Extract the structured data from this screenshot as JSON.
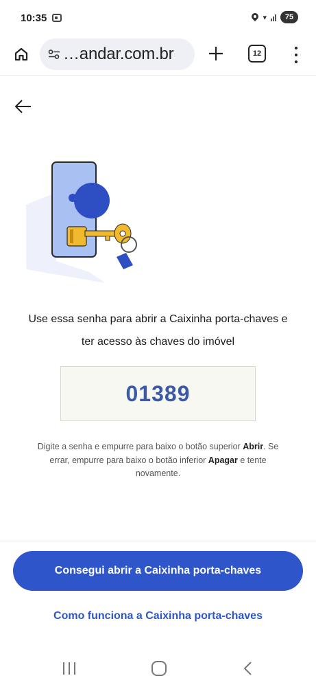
{
  "status_bar": {
    "time": "10:35",
    "battery": "75"
  },
  "browser": {
    "url": "…andar.com.br",
    "tab_count": "12",
    "icons": [
      "home-icon",
      "site-settings-icon",
      "plus-icon",
      "tab-switcher-icon",
      "more-vert-icon"
    ]
  },
  "page": {
    "instruction": "Use essa senha para abrir a Caixinha porta-chaves e ter acesso às chaves do imóvel",
    "code": "01389",
    "help": {
      "part1": "Digite a senha e empurre para baixo o botão superior ",
      "abrir": "Abrir",
      "part2": ". Se errar, empurre para baixo o botão inferior ",
      "apagar": "Apagar",
      "part3": " e tente novamente."
    },
    "primary_button": "Consegui abrir a Caixinha porta-chaves",
    "secondary_link": "Como funciona a Caixinha porta-chaves"
  },
  "colors": {
    "accent": "#2e55c9",
    "code_text": "#3a5aa8",
    "code_box_bg": "#f7f8f2",
    "illustration_door": "#a9c1f2",
    "illustration_knob": "#2e4fc4",
    "illustration_key": "#f0b92e"
  }
}
